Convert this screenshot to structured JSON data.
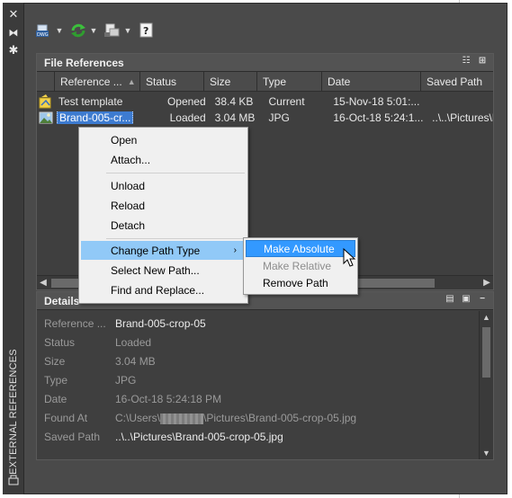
{
  "palette": {
    "vertical_title": "EXTERNAL REFERENCES",
    "titlebar_icons": [
      "close-icon",
      "auto-hide-icon",
      "properties-icon"
    ]
  },
  "toolbar": {
    "buttons": [
      {
        "name": "attach-dwg-button",
        "icon": "attach-dwg-icon",
        "has_dropdown": true
      },
      {
        "name": "refresh-button",
        "icon": "refresh-icon",
        "has_dropdown": true
      },
      {
        "name": "change-path-button",
        "icon": "change-path-icon",
        "has_dropdown": true
      },
      {
        "name": "help-button",
        "icon": "help-icon",
        "has_dropdown": false
      }
    ]
  },
  "file_references": {
    "title": "File References",
    "tools": [
      "list-view-icon",
      "tree-view-icon"
    ],
    "columns": [
      "Reference ...",
      "Status",
      "Size",
      "Type",
      "Date",
      "Saved Path"
    ],
    "sort_column": "Reference ...",
    "rows": [
      {
        "icon": "drawing-icon",
        "name": "Test template",
        "status": "Opened",
        "size": "38.4 KB",
        "type": "Current",
        "date": "15-Nov-18 5:01:...",
        "saved_path": "",
        "selected": false
      },
      {
        "icon": "image-icon",
        "name": "Brand-005-cr...",
        "status": "Loaded",
        "size": "3.04 MB",
        "type": "JPG",
        "date": "16-Oct-18 5:24:1...",
        "saved_path": "..\\..\\Pictures\\Bra",
        "selected": true
      }
    ]
  },
  "details": {
    "title": "Details",
    "tools": [
      "details-icon",
      "preview-icon",
      "collapse-icon"
    ],
    "fields": [
      {
        "label": "Reference ...",
        "value": "Brand-005-crop-05",
        "strong": true
      },
      {
        "label": "Status",
        "value": "Loaded",
        "strong": false
      },
      {
        "label": "Size",
        "value": "3.04 MB",
        "strong": false
      },
      {
        "label": "Type",
        "value": "JPG",
        "strong": false
      },
      {
        "label": "Date",
        "value": "16-Oct-18 5:24:18 PM",
        "strong": false
      },
      {
        "label": "Found At",
        "value_prefix": "C:\\Users\\",
        "value_suffix": "\\Pictures\\Brand-005-crop-05.jpg",
        "redacted": true,
        "strong": false
      },
      {
        "label": "Saved Path",
        "value": "..\\..\\Pictures\\Brand-005-crop-05.jpg",
        "strong": true
      }
    ]
  },
  "context_menu": {
    "items": [
      "Open",
      "Attach...",
      "Unload",
      "Reload",
      "Detach",
      "Change Path Type",
      "Select New Path...",
      "Find and Replace..."
    ],
    "highlighted": "Change Path Type"
  },
  "submenu": {
    "items": [
      {
        "label": "Make Absolute",
        "state": "highlighted"
      },
      {
        "label": "Make Relative",
        "state": "disabled"
      },
      {
        "label": "Remove Path",
        "state": "normal"
      }
    ]
  },
  "colors": {
    "panel_bg": "#4a4a4a",
    "menu_bg": "#f0f0f0",
    "menu_highlight": "#91c9f7",
    "submenu_highlight": "#3399ff",
    "selection": "#3d7bd0"
  }
}
